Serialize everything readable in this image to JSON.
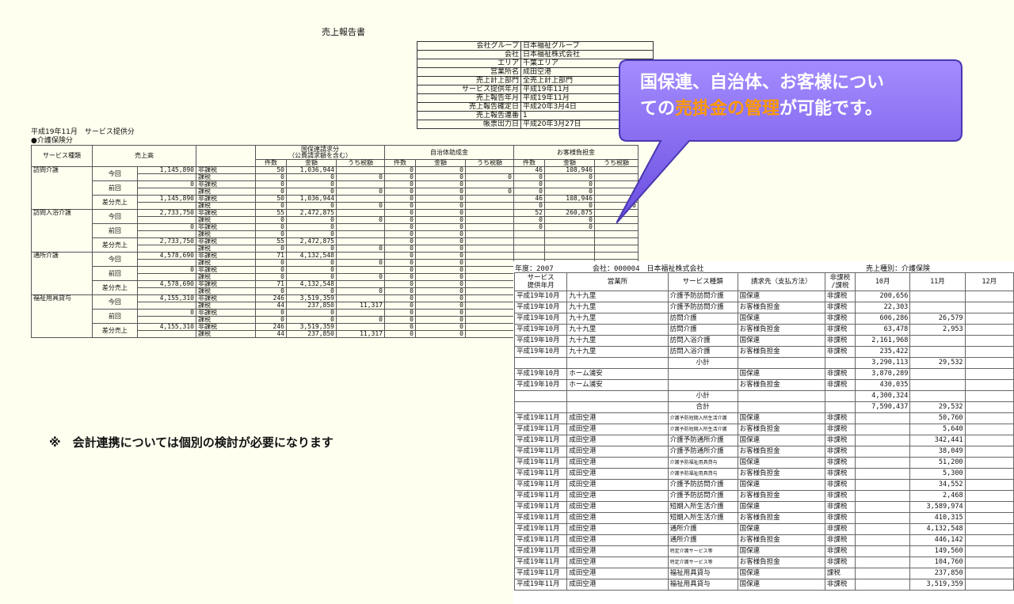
{
  "report": {
    "title": "売上報告書",
    "header": [
      {
        "k": "会社グループ",
        "v": "日本福祉グループ"
      },
      {
        "k": "会社",
        "v": "日本福祉株式会社"
      },
      {
        "k": "エリア",
        "v": "千葉エリア"
      },
      {
        "k": "営業所名",
        "v": "成田空港"
      },
      {
        "k": "売上計上部門",
        "v": "全売上計上部門"
      },
      {
        "k": "サービス提供年月",
        "v": "平成19年11月"
      },
      {
        "k": "売上報告年月",
        "v": "平成19年11月"
      },
      {
        "k": "売上報告確定日",
        "v": "平成20年3月4日"
      },
      {
        "k": "売上報告連番",
        "v": "1"
      },
      {
        "k": "帳票出力日",
        "v": "平成20年3月27日"
      }
    ],
    "period_label": "平成19年11月　サービス提供分",
    "section_label": "●介護保険分",
    "col_service": "サービス種類",
    "col_sales": "売上高",
    "group_kokuho": "国保連請求分",
    "group_kokuho_sub": "（公費請求額を含む）",
    "group_jichitai": "自治体助成金",
    "group_okyaku": "お客様負担金",
    "sub_headers": [
      "件数",
      "金額",
      "うち税額",
      "件数",
      "金額",
      "うち税額",
      "件数",
      "金額",
      "うち税額"
    ],
    "services": [
      {
        "name": "訪問介護",
        "rows": [
          {
            "label": "今回",
            "amount": "1,145,890",
            "lines": [
              [
                "非課税",
                "50",
                "1,036,944",
                "",
                "0",
                "0",
                "",
                "46",
                "108,946",
                ""
              ],
              [
                "課税",
                "0",
                "0",
                "0",
                "0",
                "0",
                "0",
                "0",
                "0",
                ""
              ]
            ]
          },
          {
            "label": "前回",
            "amount": "0",
            "lines": [
              [
                "非課税",
                "0",
                "0",
                "",
                "0",
                "0",
                "",
                "0",
                "0",
                ""
              ],
              [
                "課税",
                "0",
                "0",
                "0",
                "0",
                "0",
                "0",
                "0",
                "0",
                ""
              ]
            ]
          },
          {
            "label": "差分売上",
            "amount": "1,145,890",
            "lines": [
              [
                "非課税",
                "50",
                "1,036,944",
                "",
                "0",
                "0",
                "",
                "46",
                "108,946",
                ""
              ],
              [
                "課税",
                "0",
                "0",
                "0",
                "0",
                "0",
                "",
                "0",
                "0",
                "0"
              ]
            ]
          }
        ]
      },
      {
        "name": "訪問入浴介護",
        "rows": [
          {
            "label": "今回",
            "amount": "2,733,750",
            "lines": [
              [
                "非課税",
                "55",
                "2,472,875",
                "",
                "0",
                "0",
                "",
                "52",
                "260,875",
                ""
              ],
              [
                "課税",
                "0",
                "0",
                "0",
                "0",
                "0",
                "",
                "0",
                "0",
                ""
              ]
            ]
          },
          {
            "label": "前回",
            "amount": "0",
            "lines": [
              [
                "非課税",
                "0",
                "0",
                "",
                "0",
                "0",
                "",
                "0",
                "0",
                ""
              ],
              [
                "課税",
                "0",
                "0",
                "",
                "0",
                "0",
                "",
                "",
                "",
                ""
              ]
            ]
          },
          {
            "label": "差分売上",
            "amount": "2,733,750",
            "lines": [
              [
                "非課税",
                "55",
                "2,472,875",
                "",
                "0",
                "0",
                "",
                "",
                "",
                ""
              ],
              [
                "課税",
                "0",
                "0",
                "0",
                "0",
                "0",
                "",
                "",
                "",
                ""
              ]
            ]
          }
        ]
      },
      {
        "name": "通所介護",
        "rows": [
          {
            "label": "今回",
            "amount": "4,578,690",
            "lines": [
              [
                "非課税",
                "71",
                "4,132,548",
                "",
                "0",
                "0",
                "",
                "",
                "",
                ""
              ],
              [
                "課税",
                "0",
                "0",
                "0",
                "0",
                "0",
                "",
                "",
                "",
                ""
              ]
            ]
          },
          {
            "label": "前回",
            "amount": "0",
            "lines": [
              [
                "非課税",
                "0",
                "0",
                "",
                "0",
                "0",
                "",
                "",
                "",
                ""
              ],
              [
                "課税",
                "0",
                "0",
                "0",
                "0",
                "0",
                "",
                "",
                "",
                ""
              ]
            ]
          },
          {
            "label": "差分売上",
            "amount": "4,578,690",
            "lines": [
              [
                "非課税",
                "71",
                "4,132,548",
                "",
                "0",
                "0",
                "",
                "",
                "",
                ""
              ],
              [
                "課税",
                "0",
                "0",
                "0",
                "0",
                "0",
                "",
                "",
                "",
                ""
              ]
            ]
          }
        ]
      },
      {
        "name": "福祉用具貸与",
        "rows": [
          {
            "label": "今回",
            "amount": "4,155,310",
            "lines": [
              [
                "非課税",
                "246",
                "3,519,359",
                "",
                "0",
                "0",
                "",
                "",
                "",
                ""
              ],
              [
                "課税",
                "44",
                "237,850",
                "11,317",
                "0",
                "0",
                "",
                "",
                "",
                ""
              ]
            ]
          },
          {
            "label": "前回",
            "amount": "0",
            "lines": [
              [
                "非課税",
                "0",
                "0",
                "",
                "0",
                "0",
                "",
                "",
                "",
                ""
              ],
              [
                "課税",
                "0",
                "0",
                "0",
                "0",
                "0",
                "",
                "",
                "",
                ""
              ]
            ]
          },
          {
            "label": "差分売上",
            "amount": "4,155,310",
            "lines": [
              [
                "非課税",
                "246",
                "3,519,359",
                "",
                "0",
                "0",
                "",
                "",
                "",
                ""
              ],
              [
                "課税",
                "44",
                "237,850",
                "11,317",
                "0",
                "0",
                "",
                "",
                "",
                ""
              ]
            ]
          }
        ]
      }
    ]
  },
  "callout": {
    "line1": "国保連、自治体、お客様につい",
    "line2_pre": "ての",
    "line2_em": "売掛金の管理",
    "line2_post": "が可能です。",
    "fill": "#7b68ee"
  },
  "note": "※　会計連携については個別の検討が必要になります",
  "sheet2": {
    "fiscal_year": "年度：2007",
    "company": "会社：000004　日本福祉株式会社",
    "sales_type": "売上種別：介護保険",
    "headers": [
      "サービス\n提供年月",
      "営業所",
      "サービス種類",
      "請求先（支払方法）",
      "非課税\n/課税",
      "10月",
      "11月",
      "12月"
    ],
    "rows": [
      [
        "平成19年10月",
        "九十九里",
        "介護予防訪問介護",
        "国保連",
        "非課税",
        "200,656",
        "",
        ""
      ],
      [
        "平成19年10月",
        "九十九里",
        "介護予防訪問介護",
        "お客様負担金",
        "非課税",
        "22,303",
        "",
        ""
      ],
      [
        "平成19年10月",
        "九十九里",
        "訪問介護",
        "国保連",
        "非課税",
        "606,286",
        "26,579",
        ""
      ],
      [
        "平成19年10月",
        "九十九里",
        "訪問介護",
        "お客様負担金",
        "非課税",
        "63,478",
        "2,953",
        ""
      ],
      [
        "平成19年10月",
        "九十九里",
        "訪問入浴介護",
        "国保連",
        "非課税",
        "2,161,968",
        "",
        ""
      ],
      [
        "平成19年10月",
        "九十九里",
        "訪問入浴介護",
        "お客様負担金",
        "非課税",
        "235,422",
        "",
        ""
      ],
      [
        "",
        "",
        "小計",
        "",
        "",
        "3,290,113",
        "29,532",
        ""
      ],
      [
        "平成19年10月",
        "ホーム浦安",
        "",
        "国保連",
        "非課税",
        "3,870,289",
        "",
        ""
      ],
      [
        "平成19年10月",
        "ホーム浦安",
        "",
        "お客様負担金",
        "非課税",
        "430,035",
        "",
        ""
      ],
      [
        "",
        "",
        "小計",
        "",
        "",
        "4,300,324",
        "",
        ""
      ],
      [
        "",
        "",
        "合計",
        "",
        "",
        "7,590,437",
        "29,532",
        ""
      ],
      [
        "平成19年11月",
        "成田空港",
        "介護予防短期入所生活介護",
        "国保連",
        "非課税",
        "",
        "50,760",
        ""
      ],
      [
        "平成19年11月",
        "成田空港",
        "介護予防短期入所生活介護",
        "お客様負担金",
        "非課税",
        "",
        "5,640",
        ""
      ],
      [
        "平成19年11月",
        "成田空港",
        "介護予防通所介護",
        "国保連",
        "非課税",
        "",
        "342,441",
        ""
      ],
      [
        "平成19年11月",
        "成田空港",
        "介護予防通所介護",
        "お客様負担金",
        "非課税",
        "",
        "38,049",
        ""
      ],
      [
        "平成19年11月",
        "成田空港",
        "介護予防福祉用具貸与",
        "国保連",
        "非課税",
        "",
        "51,200",
        ""
      ],
      [
        "平成19年11月",
        "成田空港",
        "介護予防福祉用具貸与",
        "お客様負担金",
        "非課税",
        "",
        "5,300",
        ""
      ],
      [
        "平成19年11月",
        "成田空港",
        "介護予防訪問介護",
        "国保連",
        "非課税",
        "",
        "34,552",
        ""
      ],
      [
        "平成19年11月",
        "成田空港",
        "介護予防訪問介護",
        "お客様負担金",
        "非課税",
        "",
        "2,468",
        ""
      ],
      [
        "平成19年11月",
        "成田空港",
        "短期入所生活介護",
        "国保連",
        "非課税",
        "",
        "3,589,974",
        ""
      ],
      [
        "平成19年11月",
        "成田空港",
        "短期入所生活介護",
        "お客様負担金",
        "非課税",
        "",
        "410,315",
        ""
      ],
      [
        "平成19年11月",
        "成田空港",
        "通所介護",
        "国保連",
        "非課税",
        "",
        "4,132,548",
        ""
      ],
      [
        "平成19年11月",
        "成田空港",
        "通所介護",
        "お客様負担金",
        "非課税",
        "",
        "446,142",
        ""
      ],
      [
        "平成19年11月",
        "成田空港",
        "特定介護サービス等",
        "国保連",
        "非課税",
        "",
        "149,560",
        ""
      ],
      [
        "平成19年11月",
        "成田空港",
        "特定介護サービス等",
        "お客様負担金",
        "非課税",
        "",
        "104,760",
        ""
      ],
      [
        "平成19年11月",
        "成田空港",
        "福祉用具貸与",
        "国保連",
        "課税",
        "",
        "237,850",
        ""
      ],
      [
        "平成19年11月",
        "成田空港",
        "福祉用具貸与",
        "国保連",
        "非課税",
        "",
        "3,519,359",
        ""
      ]
    ]
  }
}
